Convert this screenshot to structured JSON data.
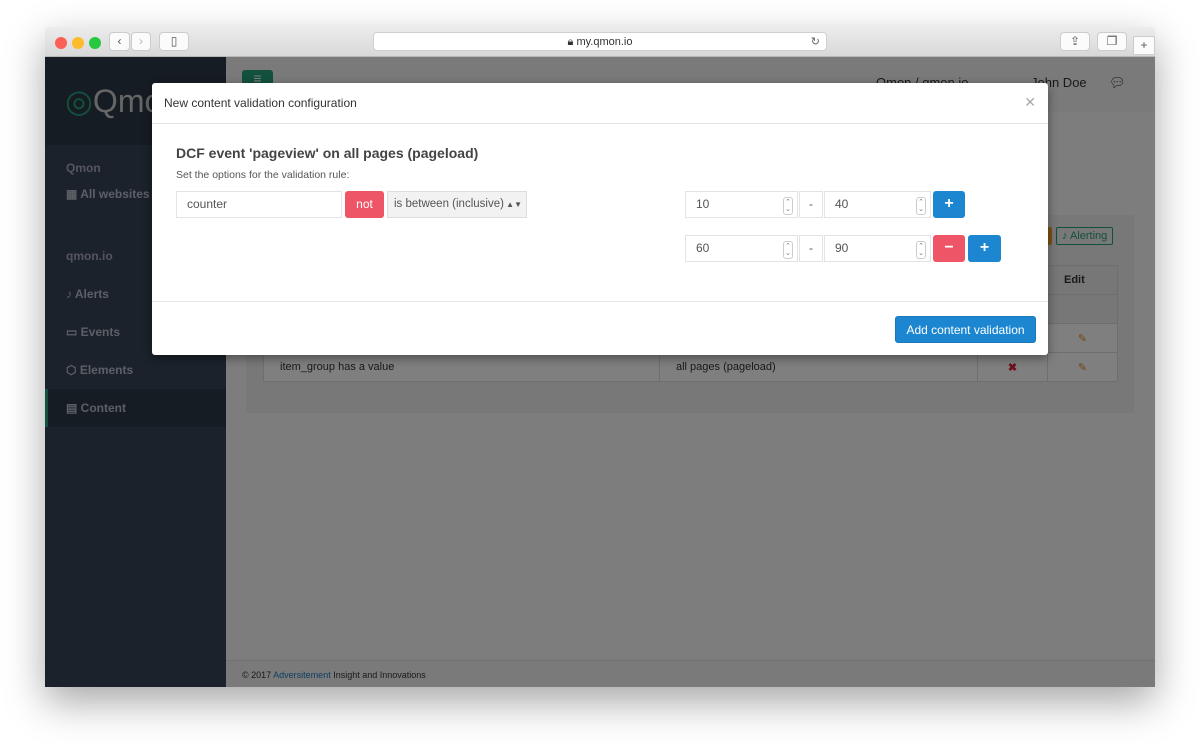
{
  "browser": {
    "url": "my.qmon.io"
  },
  "sidebar": {
    "logo": "Qmon",
    "section1": "Qmon",
    "all_websites": "All websites",
    "section2": "qmon.io",
    "items": [
      {
        "label": "Alerts"
      },
      {
        "label": "Events"
      },
      {
        "label": "Elements"
      },
      {
        "label": "Content"
      }
    ]
  },
  "header": {
    "breadcrumb": "Qmon / qmon.io",
    "user": "John Doe"
  },
  "panel": {
    "badge_alerting": "Alerting",
    "col_edit": "Edit",
    "rows": [
      {
        "rule": "item_group has a value",
        "scope": "all pages (pageload)"
      }
    ]
  },
  "footer": {
    "prefix": "© 2017 ",
    "link": "Adversitement",
    "suffix": " Insight and Innovations"
  },
  "modal": {
    "title": "New content validation configuration",
    "heading": "DCF event 'pageview' on all pages (pageload)",
    "instruction": "Set the options for the validation rule:",
    "field": "counter",
    "not_label": "not",
    "operator": "is between (inclusive)",
    "ranges": [
      {
        "from": "10",
        "to": "40"
      },
      {
        "from": "60",
        "to": "90"
      }
    ],
    "separator": "-",
    "submit": "Add content validation"
  },
  "colors": {
    "accent": "#1c87d0",
    "danger": "#ee5566",
    "brand": "#26a17b"
  }
}
